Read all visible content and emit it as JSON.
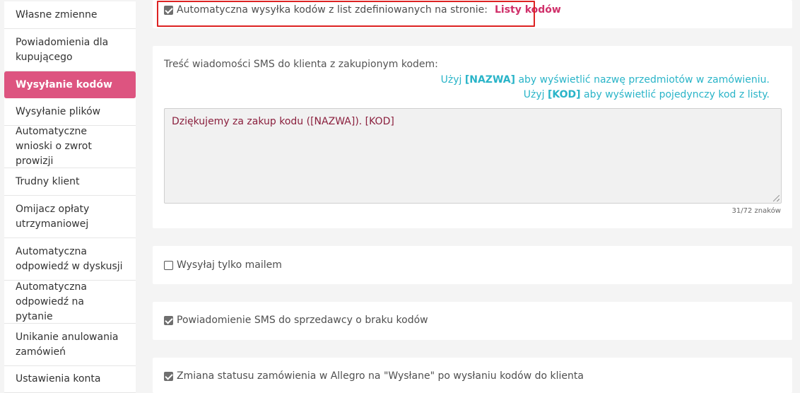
{
  "sidebar": {
    "items": [
      {
        "label": "Własne zmienne",
        "active": false
      },
      {
        "label": "Powiadomienia dla kupującego",
        "active": false
      },
      {
        "label": "Wysyłanie kodów",
        "active": true
      },
      {
        "label": "Wysyłanie plików",
        "active": false
      },
      {
        "label": "Automatyczne wnioski o zwrot prowizji",
        "active": false
      },
      {
        "label": "Trudny klient",
        "active": false
      },
      {
        "label": "Omijacz opłaty utrzymaniowej",
        "active": false
      },
      {
        "label": "Automatyczna odpowiedź w dyskusji",
        "active": false
      },
      {
        "label": "Automatyczna odpowiedź na pytanie",
        "active": false
      },
      {
        "label": "Unikanie anulowania zamówień",
        "active": false
      },
      {
        "label": "Ustawienia konta",
        "active": false
      }
    ]
  },
  "auto_send": {
    "label": "Automatyczna wysyłka kodów z list zdefiniowanych na stronie:",
    "link": "Listy kodów",
    "checked": true
  },
  "sms": {
    "heading": "Treść wiadomości SMS do klienta z zakupionym kodem:",
    "hint1": {
      "pre": "Użyj ",
      "token": "[NAZWA]",
      "post": " aby wyświetlić nazwę przedmiotów w zamówieniu."
    },
    "hint2": {
      "pre": "Użyj ",
      "token": "[KOD]",
      "post": " aby wyświetlić pojedynczy kod z listy."
    },
    "message": "Dziękujemy za zakup kodu ([NAZWA]). [KOD]",
    "char_count": "31/72 znaków"
  },
  "options": {
    "email_only": {
      "label": "Wysyłaj tylko mailem",
      "checked": false
    },
    "sms_notify": {
      "label": "Powiadomienie SMS do sprzedawcy o braku kodów",
      "checked": true
    },
    "status_change": {
      "label": "Zmiana statusu zamówienia w Allegro na \"Wysłane\" po wysłaniu kodów do klienta",
      "checked": true
    }
  },
  "colors": {
    "accent": "#dd5480",
    "link": "#d0306a",
    "hint": "#29b4c8",
    "highlight": "#dd2222"
  }
}
